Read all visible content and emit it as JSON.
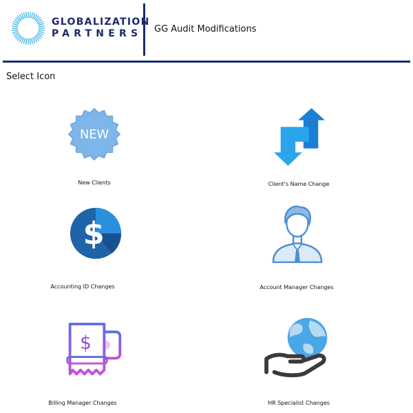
{
  "header": {
    "logo_line1": "GLOBALIZATION",
    "logo_line2": "PARTNERS",
    "app_title": "GG Audit Modifications"
  },
  "main": {
    "select_label": "Select Icon",
    "tiles": [
      {
        "label": "New Clients",
        "icon": "new-badge-icon",
        "badge_text": "NEW"
      },
      {
        "label": "Client's Name Change",
        "icon": "swap-arrows-icon"
      },
      {
        "label": "Accounting ID Changes",
        "icon": "dollar-coin-icon",
        "glyph": "$"
      },
      {
        "label": "Account Manager Changes",
        "icon": "person-icon"
      },
      {
        "label": "Billing Manager Changes",
        "icon": "bill-receipt-icon",
        "glyph": "$"
      },
      {
        "label": "HR Specialist Changes",
        "icon": "hand-globe-icon"
      }
    ]
  },
  "colors": {
    "brand_navy": "#1b2a6b",
    "logo_ring": "#3bb3e6",
    "badge_blue": "#7fb6ea",
    "arrow_blue": "#2aa5ec",
    "coin_blue": "#1f63a8",
    "person_line": "#4a8fd3",
    "billing_purple": "#8a4fe0",
    "globe_blue": "#4aa7e8",
    "hand_gray": "#3a3a3a"
  }
}
